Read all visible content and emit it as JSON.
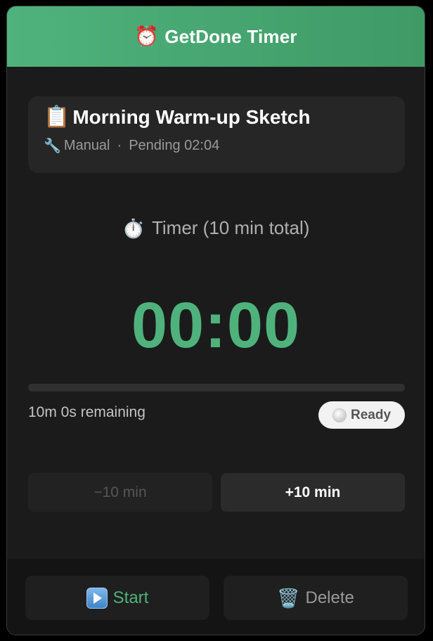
{
  "header": {
    "icon": "alarm-clock-icon",
    "icon_glyph": "⏰",
    "title": "GetDone Timer",
    "accent_color": "#4fb27c"
  },
  "task": {
    "icon": "clipboard-icon",
    "icon_glyph": "📋",
    "title": "Morning Warm-up Sketch",
    "mode_icon": "wrench-icon",
    "mode_icon_glyph": "🔧",
    "mode": "Manual",
    "separator": "·",
    "pending": "Pending 02:04"
  },
  "timer": {
    "icon": "stopwatch-icon",
    "icon_glyph": "⏱️",
    "label": "Timer (10 min total)",
    "display": "00:00",
    "progress_percent": 0,
    "remaining": "10m 0s remaining",
    "status": "Ready",
    "status_icon": "white-circle-icon"
  },
  "adjust": {
    "minus_label": "−10 min",
    "plus_label": "+10 min"
  },
  "footer": {
    "start_icon": "play-button-icon",
    "start_label": "Start",
    "delete_icon": "wastebasket-icon",
    "delete_icon_glyph": "🗑️",
    "delete_label": "Delete"
  }
}
